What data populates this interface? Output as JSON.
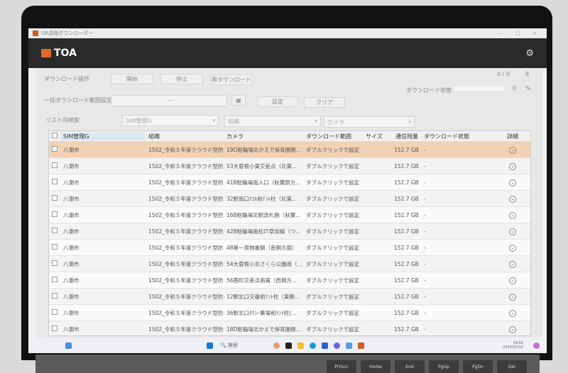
{
  "window": {
    "title": "GR遠隔ダウンローダー",
    "brand": "TOA"
  },
  "controls": {
    "download_ops_label": "ダウンロード操作",
    "start": "開始",
    "stop": "停止",
    "redownload": "再ダウンロード",
    "range_label": "一括ダウンロード範囲設定",
    "range_value": "～",
    "set": "設定",
    "clear": "クリア",
    "search_label": "リスト内検索",
    "filter_sim": "SIM管理G",
    "filter_org": "組織",
    "filter_camera": "カメラ",
    "status_label": "ダウンロード状態",
    "count_done": "0 /",
    "count_total": "0",
    "count_unit": "8",
    "percent": "0",
    "percent_unit": "%",
    "progress_percent": 0
  },
  "table": {
    "columns": [
      "SIM管理G",
      "組織",
      "カメラ",
      "ダウンロード範囲",
      "サイズ",
      "通信残量",
      "ダウンロード状態",
      "詳細"
    ],
    "rows": [
      {
        "sim": "八潮市",
        "org": "1502_令和５年度クラウド型防...",
        "camera": "19D駐輪場北かえで保育園側...",
        "range": "ダブルクリックで設定",
        "size": "",
        "remaining": "152.7 GB",
        "status": "-"
      },
      {
        "sim": "八潮市",
        "org": "1502_令和５年度クラウド型防...",
        "camera": "53大曽根小東交差点（北東...",
        "range": "ダブルクリックで設定",
        "size": "",
        "remaining": "152.7 GB",
        "status": "-"
      },
      {
        "sim": "八潮市",
        "org": "1502_令和５年度クラウド型防...",
        "camera": "41B駐輪場南入口（秋葉原方...",
        "range": "ダブルクリックで設定",
        "size": "",
        "remaining": "152.7 GB",
        "status": "-"
      },
      {
        "sim": "八潮市",
        "org": "1502_令和５年度クラウド型防...",
        "camera": "32駅南口ｱｺﾙ前ﾃﾝﾄ柱（北東...",
        "range": "ダブルクリックで設定",
        "size": "",
        "remaining": "152.7 GB",
        "status": "-"
      },
      {
        "sim": "八潮市",
        "org": "1502_令和５年度クラウド型防...",
        "camera": "16B駐輪場北駅改札側（秋葉...",
        "range": "ダブルクリックで設定",
        "size": "",
        "remaining": "152.7 GB",
        "status": "-"
      },
      {
        "sim": "八潮市",
        "org": "1502_令和５年度クラウド型防...",
        "camera": "42B駐輪場南松戸草加線（つ...",
        "range": "ダブルクリックで設定",
        "size": "",
        "remaining": "152.7 GB",
        "status": "-"
      },
      {
        "sim": "八潮市",
        "org": "1502_令和５年度クラウド型防...",
        "camera": "48第一貨物裏側（南側方面）",
        "range": "ダブルクリックで設定",
        "size": "",
        "remaining": "152.7 GB",
        "status": "-"
      },
      {
        "sim": "八潮市",
        "org": "1502_令和５年度クラウド型防...",
        "camera": "54大曽根小北さくら公園南（...",
        "range": "ダブルクリックで設定",
        "size": "",
        "remaining": "152.7 GB",
        "status": "-"
      },
      {
        "sim": "八潮市",
        "org": "1502_令和５年度クラウド型防...",
        "camera": "56茜町交差点南東（西側方...",
        "range": "ダブルクリックで設定",
        "size": "",
        "remaining": "152.7 GB",
        "status": "-"
      },
      {
        "sim": "八潮市",
        "org": "1502_令和５年度クラウド型防...",
        "camera": "12駅北口交番前ﾃﾝﾄ柱（東側...",
        "range": "ダブルクリックで設定",
        "size": "",
        "remaining": "152.7 GB",
        "status": "-"
      },
      {
        "sim": "八潮市",
        "org": "1502_令和５年度クラウド型防...",
        "camera": "36駅北口ﾀｸｼｰ乗場前ﾃﾝﾄ柱(...",
        "range": "ダブルクリックで設定",
        "size": "",
        "remaining": "152.7 GB",
        "status": "-"
      },
      {
        "sim": "八潮市",
        "org": "1502_令和５年度クラウド型防...",
        "camera": "18D駐輪場北かえで保育園側...",
        "range": "ダブルクリックで設定",
        "size": "",
        "remaining": "152.7 GB",
        "status": "-"
      }
    ]
  },
  "taskbar": {
    "search": "検索",
    "time": "14:02",
    "date": "2024/07/12"
  },
  "keyboard": [
    "PrtScn",
    "Home",
    "End",
    "PgUp",
    "PgDn",
    "Del"
  ],
  "colors": {
    "selected_row": "#f2d2b4",
    "header": "#2a2a2d",
    "brand": "#e06a2a"
  }
}
